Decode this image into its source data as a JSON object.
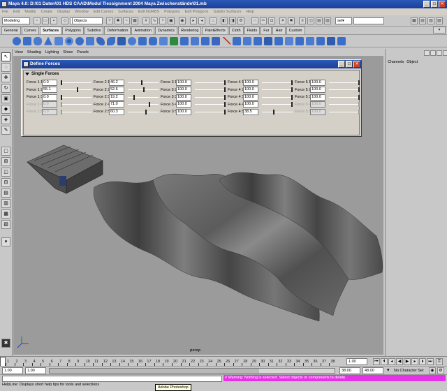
{
  "window": {
    "title": "Maya 4.0: D:\\01 Daten\\01 HDS CAAD\\Modul Tiessignment 2004 Maya Zwischenstände\\01.mb",
    "min": "_",
    "max": "□",
    "close": "✕"
  },
  "menubar": [
    "File",
    "Edit",
    "Modify",
    "Create",
    "Display",
    "Window",
    "Edit Curves",
    "Surfaces",
    "Edit NURBS",
    "Polygons",
    "Edit Polygons",
    "Subdiv Surfaces",
    "Help"
  ],
  "status_line": {
    "mode": "Modeling",
    "objects_label": "Objects",
    "selection_field": "sel▾"
  },
  "shelf_tabs": [
    "General",
    "Curves",
    "Surfaces",
    "Polygons",
    "Subdivs",
    "Deformation",
    "Animation",
    "Dynamics",
    "Rendering",
    "PaintEffects",
    "Cloth",
    "Fluids",
    "Fur",
    "Hair",
    "Custom"
  ],
  "active_shelf_tab": "Surfaces",
  "panel_menu": [
    "View",
    "Shading",
    "Lighting",
    "Show",
    "Panels"
  ],
  "channel_box": {
    "channels": "Channels",
    "object": "Object"
  },
  "define_forces": {
    "title": "Define Forces",
    "section": "Single Forces",
    "columns": [
      [
        {
          "label": "Force 1 1",
          "value": "0.0",
          "pct": 0.0,
          "enabled": true
        },
        {
          "label": "Force 1 2",
          "value": "55.1",
          "pct": 0.551,
          "enabled": true
        },
        {
          "label": "Force 1 3",
          "value": "0.0",
          "pct": 0.0,
          "enabled": true
        },
        {
          "label": "Force 1 4",
          "value": "0.0",
          "pct": 0.0,
          "enabled": false
        },
        {
          "label": "Force 1 5",
          "value": "0.0",
          "pct": 0.0,
          "enabled": false
        }
      ],
      [
        {
          "label": "Force 2 1",
          "value": "46.2",
          "pct": 0.462,
          "enabled": true
        },
        {
          "label": "Force 2 2",
          "value": "52.6",
          "pct": 0.526,
          "enabled": true
        },
        {
          "label": "Force 2 3",
          "value": "19.2",
          "pct": 0.192,
          "enabled": true
        },
        {
          "label": "Force 2 4",
          "value": "71.0",
          "pct": 0.71,
          "enabled": true
        },
        {
          "label": "Force 2 5",
          "value": "60.3",
          "pct": 0.603,
          "enabled": true
        }
      ],
      [
        {
          "label": "Force 3 1",
          "value": "100.0",
          "pct": 1.0,
          "enabled": true
        },
        {
          "label": "Force 3 2",
          "value": "100.0",
          "pct": 1.0,
          "enabled": true
        },
        {
          "label": "Force 3 3",
          "value": "100.0",
          "pct": 1.0,
          "enabled": true
        },
        {
          "label": "Force 3 4",
          "value": "100.0",
          "pct": 1.0,
          "enabled": true
        },
        {
          "label": "Force 3 5",
          "value": "100.0",
          "pct": 1.0,
          "enabled": true
        }
      ],
      [
        {
          "label": "Force 4 1",
          "value": "100.0",
          "pct": 1.0,
          "enabled": true
        },
        {
          "label": "Force 4 2",
          "value": "100.0",
          "pct": 1.0,
          "enabled": true
        },
        {
          "label": "Force 4 3",
          "value": "100.0",
          "pct": 1.0,
          "enabled": true
        },
        {
          "label": "Force 4 4",
          "value": "100.0",
          "pct": 1.0,
          "enabled": true
        },
        {
          "label": "Force 4 5",
          "value": "38.5",
          "pct": 0.385,
          "enabled": true
        }
      ],
      [
        {
          "label": "Force 5 1",
          "value": "100.0",
          "pct": 1.0,
          "enabled": true
        },
        {
          "label": "Force 5 2",
          "value": "100.0",
          "pct": 1.0,
          "enabled": true
        },
        {
          "label": "Force 5 3",
          "value": "100.0",
          "pct": 1.0,
          "enabled": true
        },
        {
          "label": "Force 5 4",
          "value": "100.0",
          "pct": 1.0,
          "enabled": false
        },
        {
          "label": "Force 5 5",
          "value": "100.0",
          "pct": 1.0,
          "enabled": false
        }
      ]
    ]
  },
  "viewport": {
    "camera": "persp"
  },
  "time_slider": {
    "ticks": [
      "1",
      "2",
      "3",
      "4",
      "5",
      "6",
      "7",
      "8",
      "9",
      "10",
      "11",
      "12",
      "13",
      "14",
      "15",
      "16",
      "17",
      "18",
      "19",
      "20",
      "21",
      "22",
      "23",
      "24",
      "25",
      "26",
      "27",
      "28",
      "29",
      "30",
      "31",
      "32",
      "33",
      "34",
      "35",
      "36",
      "37",
      "38"
    ],
    "current_frame": "1.00"
  },
  "range_slider": {
    "start": "1.00",
    "start2": "1.00",
    "end": "38.00",
    "end2": "48.00",
    "character_set": "No Character Set"
  },
  "command_line": {
    "warning": "// Warning: Nothing is selected. Select objects or components to delete."
  },
  "help_line": "HelpLine: Displays short help tips for tools and selections",
  "taskbar_tooltip": "Adobe Photoshop",
  "colors": {
    "title_bar": "#2a59b8",
    "viewport_bg": "#9b9b9b",
    "warning_bg": "#e632e6"
  }
}
